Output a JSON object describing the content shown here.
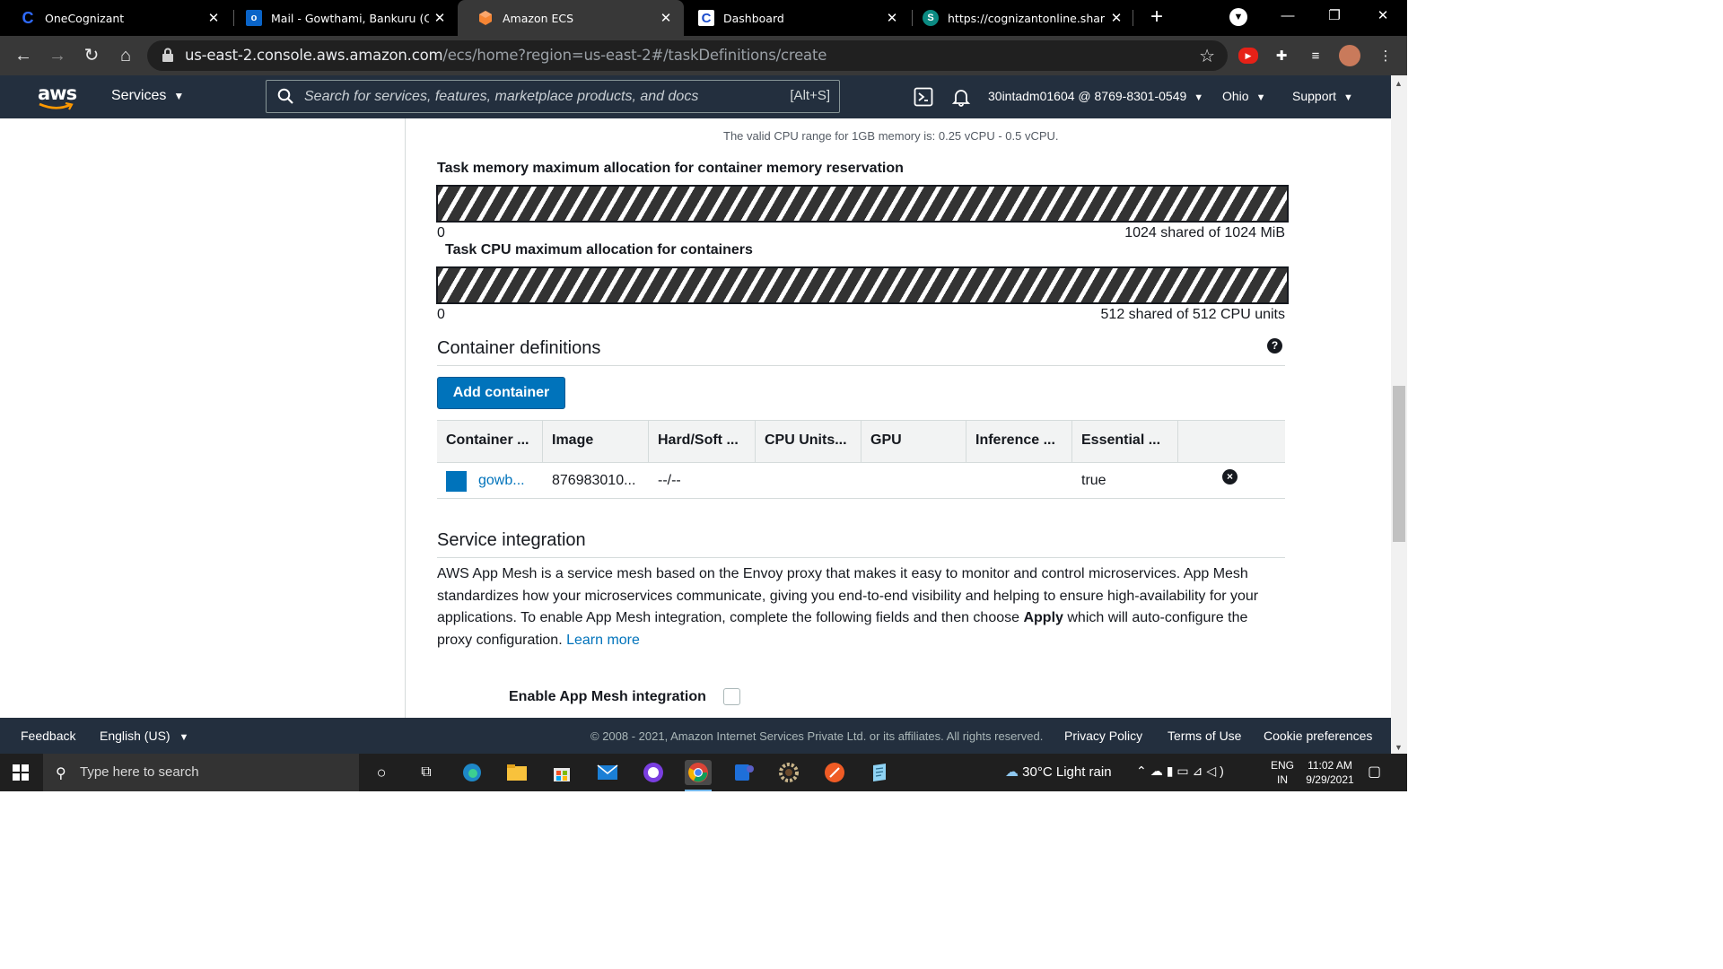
{
  "browser": {
    "tabs": [
      {
        "title": "OneCognizant",
        "favicon": "cognizant-icon",
        "favicon_text": "C",
        "favicon_color": "#1a4bcc"
      },
      {
        "title": "Mail - Gowthami, Bankuru (C",
        "favicon": "outlook-icon",
        "favicon_text": "o",
        "favicon_color": "#0a64c8"
      },
      {
        "title": "Amazon ECS",
        "favicon": "aws-ecs-icon",
        "favicon_text": "",
        "favicon_color": "#f58534",
        "active": true
      },
      {
        "title": "Dashboard",
        "favicon": "cognizant-icon",
        "favicon_text": "C",
        "favicon_color": "#1a4bcc"
      },
      {
        "title": "https://cognizantonline.shar",
        "favicon": "sharepoint-icon",
        "favicon_text": "S",
        "favicon_color": "#0b8a82"
      }
    ],
    "close_glyph": "✕",
    "new_tab_glyph": "+",
    "url_host": "us-east-2.console.aws.amazon.com",
    "url_path": "/ecs/home?region=us-east-2#/taskDefinitions/create"
  },
  "aws_header": {
    "logo_text": "aws",
    "services_label": "Services",
    "search_placeholder": "Search for services, features, marketplace products, and docs",
    "search_shortcut": "[Alt+S]",
    "account_label": "30intadm01604 @ 8769-8301-0549",
    "region_label": "Ohio",
    "support_label": "Support"
  },
  "task_size": {
    "cpu_hint": "The valid CPU range for 1GB memory is: 0.25 vCPU - 0.5 vCPU.",
    "memory_title": "Task memory maximum allocation for container memory reservation",
    "memory_min": "0",
    "memory_max_label": "1024 shared of 1024 MiB",
    "memory_fill_fraction": 1.0,
    "cpu_title": "Task CPU maximum allocation for containers",
    "cpu_min": "0",
    "cpu_max_label": "512 shared of 512 CPU units",
    "cpu_fill_fraction": 1.0
  },
  "container_definitions": {
    "title": "Container definitions",
    "help_glyph": "?",
    "add_button": "Add container",
    "columns": [
      "Container ...",
      "Image",
      "Hard/Soft ...",
      "CPU Units...",
      "GPU",
      "Inference ...",
      "Essential ..."
    ],
    "rows": [
      {
        "name": "gowb...",
        "image": "876983010...",
        "hard_soft": "--/--",
        "cpu_units": "",
        "gpu": "",
        "inference": "",
        "essential": "true"
      }
    ],
    "remove_glyph": "×"
  },
  "service_integration": {
    "title": "Service integration",
    "description_before_bold": "AWS App Mesh is a service mesh based on the Envoy proxy that makes it easy to monitor and control microservices. App Mesh standardizes how your microservices communicate, giving you end-to-end visibility and helping to ensure high-availability for your applications. To enable App Mesh integration, complete the following fields and then choose ",
    "description_bold": "Apply",
    "description_after_bold": " which will auto-configure the proxy configuration. ",
    "learn_more": "Learn more",
    "enable_label": "Enable App Mesh integration",
    "enable_checked": false
  },
  "aws_footer": {
    "feedback": "Feedback",
    "language": "English (US)",
    "copyright": "© 2008 - 2021, Amazon Internet Services Private Ltd. or its affiliates. All rights reserved.",
    "privacy": "Privacy Policy",
    "terms": "Terms of Use",
    "cookies": "Cookie preferences"
  },
  "taskbar": {
    "search_placeholder": "Type here to search",
    "weather": "30°C  Light rain",
    "lang_line1": "ENG",
    "lang_line2": "IN",
    "time": "11:02 AM",
    "date": "9/29/2021"
  },
  "colors": {
    "aws_nav": "#232f3e",
    "link": "#0073bb",
    "primary_button": "#0073bb"
  }
}
